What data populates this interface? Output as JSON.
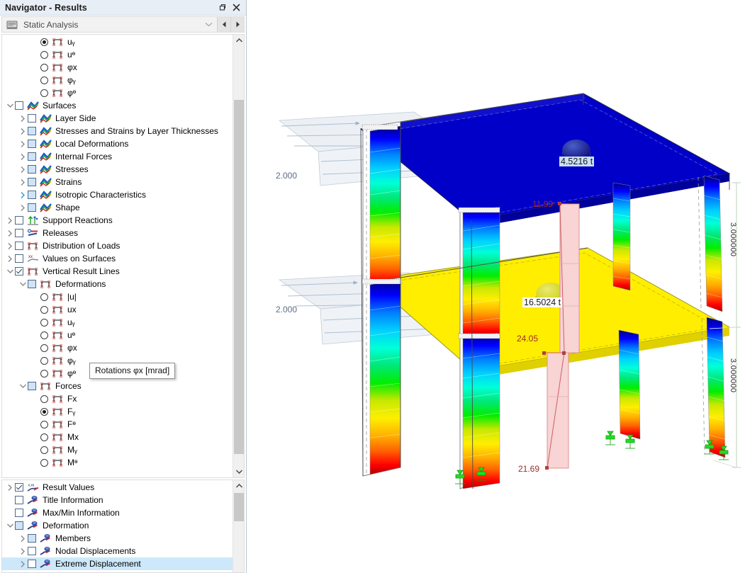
{
  "window": {
    "title": "Navigator - Results",
    "buttons": [
      {
        "name": "restore-button",
        "glyph": "restore"
      },
      {
        "name": "close-button",
        "glyph": "close"
      }
    ]
  },
  "toolbar": {
    "combo_value": "Static Analysis",
    "combo_icon": "analysis-icon",
    "prev_label": "◄",
    "next_label": "►",
    "dropdown_arrow": "⌄"
  },
  "tooltip": {
    "text": "Rotations φx  [mrad]"
  },
  "tree_top": [
    {
      "indent": 3,
      "control": "radio",
      "state": "on",
      "icon": "result-line-icon",
      "label": "uᵧ"
    },
    {
      "indent": 3,
      "control": "radio",
      "state": "off",
      "icon": "result-line-icon",
      "label": "uᶱ"
    },
    {
      "indent": 3,
      "control": "radio",
      "state": "off",
      "icon": "result-line-icon",
      "label": "φx"
    },
    {
      "indent": 3,
      "control": "radio",
      "state": "off",
      "icon": "result-line-icon",
      "label": "φᵧ"
    },
    {
      "indent": 3,
      "control": "radio",
      "state": "off",
      "icon": "result-line-icon",
      "label": "φᶱ"
    },
    {
      "indent": 1,
      "twisty": "down",
      "control": "check",
      "state": "empty",
      "icon": "surface-icon",
      "label": "Surfaces"
    },
    {
      "indent": 2,
      "twisty": "right",
      "control": "check",
      "state": "empty",
      "icon": "surface-icon",
      "label": "Layer Side"
    },
    {
      "indent": 2,
      "twisty": "right",
      "control": "check",
      "state": "filled",
      "icon": "surface-icon",
      "label": "Stresses and Strains by Layer Thicknesses"
    },
    {
      "indent": 2,
      "twisty": "right",
      "control": "check",
      "state": "filled",
      "icon": "surface-icon",
      "label": "Local Deformations"
    },
    {
      "indent": 2,
      "twisty": "right",
      "control": "check",
      "state": "filled",
      "icon": "surface-icon",
      "label": "Internal Forces"
    },
    {
      "indent": 2,
      "twisty": "right",
      "control": "check",
      "state": "filled",
      "icon": "surface-icon",
      "label": "Stresses"
    },
    {
      "indent": 2,
      "twisty": "right",
      "control": "check",
      "state": "filled",
      "icon": "surface-icon",
      "label": "Strains"
    },
    {
      "indent": 2,
      "twisty": "right-blue",
      "control": "check",
      "state": "filled",
      "icon": "surface-icon",
      "label": "Isotropic Characteristics"
    },
    {
      "indent": 2,
      "twisty": "right",
      "control": "check",
      "state": "filled",
      "icon": "surface-icon",
      "label": "Shape"
    },
    {
      "indent": 1,
      "twisty": "right",
      "control": "check",
      "state": "empty",
      "icon": "support-reaction-icon",
      "label": "Support Reactions"
    },
    {
      "indent": 1,
      "twisty": "right",
      "control": "check",
      "state": "empty",
      "icon": "release-icon",
      "label": "Releases"
    },
    {
      "indent": 1,
      "twisty": "right",
      "control": "check",
      "state": "empty",
      "icon": "result-line-icon",
      "label": "Distribution of Loads"
    },
    {
      "indent": 1,
      "twisty": "right",
      "control": "check",
      "state": "empty",
      "icon": "values-surface-icon",
      "label": "Values on Surfaces"
    },
    {
      "indent": 1,
      "twisty": "down",
      "control": "check",
      "state": "checked",
      "icon": "result-line-icon",
      "label": "Vertical Result Lines"
    },
    {
      "indent": 2,
      "twisty": "down",
      "control": "check",
      "state": "filled",
      "icon": "result-line-icon",
      "label": "Deformations"
    },
    {
      "indent": 3,
      "control": "radio",
      "state": "off",
      "icon": "result-line-icon",
      "label": "|u|"
    },
    {
      "indent": 3,
      "control": "radio",
      "state": "off",
      "icon": "result-line-icon",
      "label": "ux"
    },
    {
      "indent": 3,
      "control": "radio",
      "state": "off",
      "icon": "result-line-icon",
      "label": "uᵧ"
    },
    {
      "indent": 3,
      "control": "radio",
      "state": "off",
      "icon": "result-line-icon",
      "label": "uᶱ"
    },
    {
      "indent": 3,
      "control": "radio",
      "state": "off",
      "icon": "result-line-icon",
      "label": "φx"
    },
    {
      "indent": 3,
      "control": "radio",
      "state": "off",
      "icon": "result-line-icon",
      "label": "φᵧ"
    },
    {
      "indent": 3,
      "control": "radio",
      "state": "off",
      "icon": "result-line-icon",
      "label": "φᶱ"
    },
    {
      "indent": 2,
      "twisty": "down",
      "control": "check",
      "state": "filled",
      "icon": "result-line-icon",
      "label": "Forces"
    },
    {
      "indent": 3,
      "control": "radio",
      "state": "off",
      "icon": "result-line-icon",
      "label": "Fx"
    },
    {
      "indent": 3,
      "control": "radio",
      "state": "on",
      "icon": "result-line-icon",
      "label": "Fᵧ"
    },
    {
      "indent": 3,
      "control": "radio",
      "state": "off",
      "icon": "result-line-icon",
      "label": "Fᶱ"
    },
    {
      "indent": 3,
      "control": "radio",
      "state": "off",
      "icon": "result-line-icon",
      "label": "Mx"
    },
    {
      "indent": 3,
      "control": "radio",
      "state": "off",
      "icon": "result-line-icon",
      "label": "Mᵧ"
    },
    {
      "indent": 3,
      "control": "radio",
      "state": "off",
      "icon": "result-line-icon",
      "label": "Mᶱ"
    }
  ],
  "tree_bottom": [
    {
      "indent": 1,
      "twisty": "right",
      "control": "check",
      "state": "checked",
      "icon": "result-values-icon",
      "label": "Result Values"
    },
    {
      "indent": 1,
      "twisty": "none",
      "control": "check",
      "state": "empty",
      "icon": "info-icon",
      "label": "Title Information"
    },
    {
      "indent": 1,
      "twisty": "none",
      "control": "check",
      "state": "empty",
      "icon": "info-icon",
      "label": "Max/Min Information"
    },
    {
      "indent": 1,
      "twisty": "down",
      "control": "check",
      "state": "filled",
      "icon": "info-icon",
      "label": "Deformation"
    },
    {
      "indent": 2,
      "twisty": "right",
      "control": "check",
      "state": "filled",
      "icon": "info-icon",
      "label": "Members"
    },
    {
      "indent": 2,
      "twisty": "right",
      "control": "check",
      "state": "empty",
      "icon": "info-icon",
      "label": "Nodal Displacements"
    },
    {
      "indent": 2,
      "twisty": "right",
      "control": "check",
      "state": "empty",
      "icon": "info-icon",
      "label": "Extreme Displacement",
      "selected": true
    }
  ],
  "viewport": {
    "labels": {
      "load_upper": "2.000",
      "load_lower": "2.000",
      "value_roof": "4.5216 t",
      "value_floor": "16.5024 t",
      "result_top": "11.99",
      "result_mid": "24.05",
      "result_bottom": "21.69",
      "dim_upper": "3.000000",
      "dim_lower": "3.000000"
    },
    "colors": {
      "roof_surface": "#0000c8",
      "floor_surface": "#ffee00",
      "result_line_fill": "#f6cece",
      "result_line_stroke": "#e08888",
      "result_text": "#9e2a2a",
      "support_symbol": "#22dd22",
      "load_arrow": "#8a9cb4",
      "contour_scale": [
        "#000080",
        "#0000ff",
        "#0080ff",
        "#00d0ff",
        "#00ffc8",
        "#00e878",
        "#00ee00",
        "#b8e000",
        "#ffee00",
        "#ffb400",
        "#ff7800",
        "#ff0000",
        "#c00000"
      ]
    }
  }
}
